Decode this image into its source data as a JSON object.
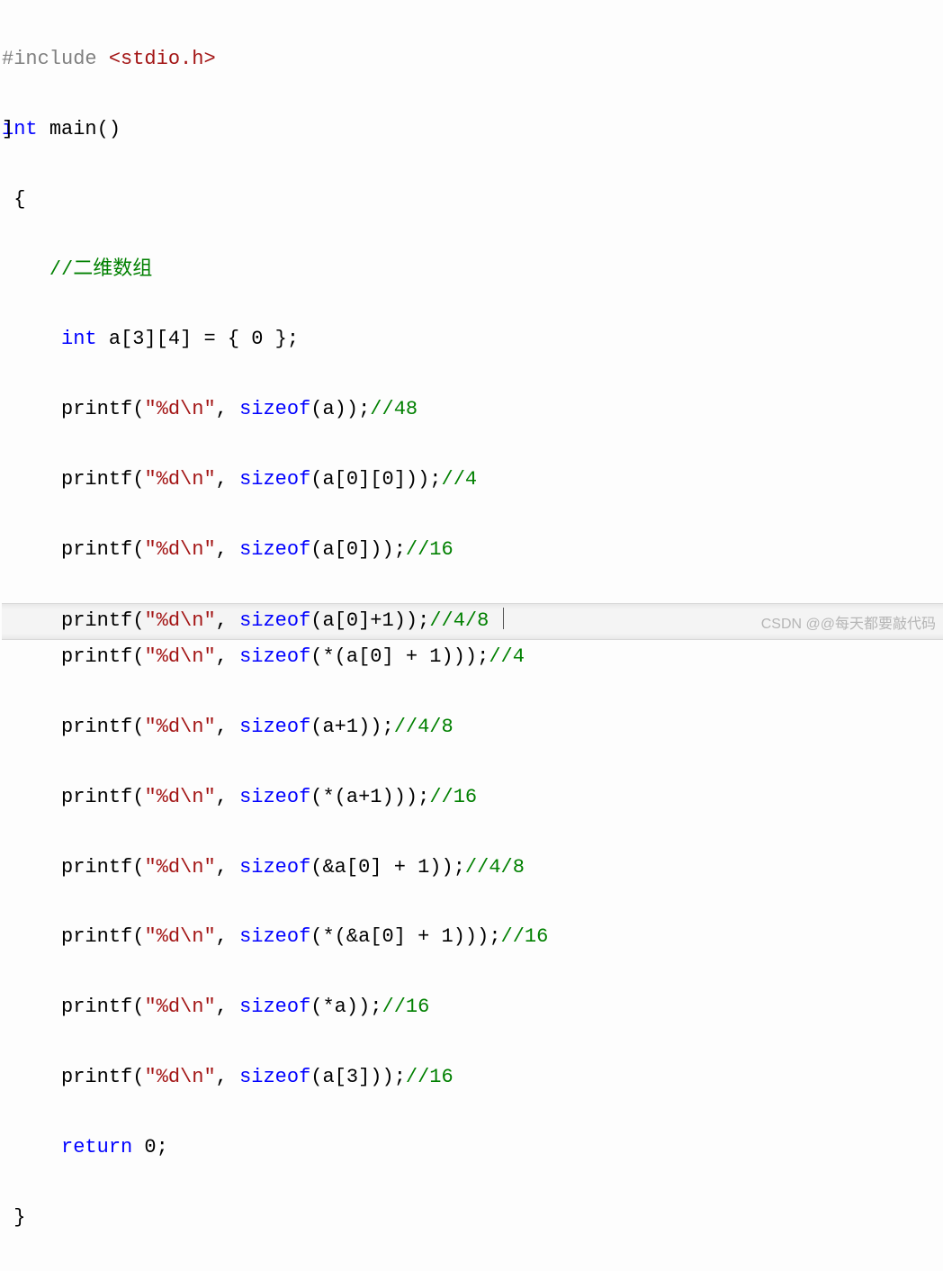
{
  "line1": {
    "preproc": "#include ",
    "path": "<stdio.h>"
  },
  "line2": {
    "kw_int": "int",
    "sp1": " ",
    "main": "main",
    "paren": "()"
  },
  "line3": {
    "brace": "{"
  },
  "line4": {
    "indent": "    ",
    "comment": "//二维数组"
  },
  "line5": {
    "indent": "     ",
    "kw_int": "int",
    "rest": " a[3][4] = { 0 };"
  },
  "line6": {
    "indent": "     ",
    "printf": "printf",
    "p1": "(",
    "str": "\"%d\\n\"",
    "comma": ", ",
    "kw_sizeof": "sizeof",
    "arg": "(a));",
    "comment": "//48"
  },
  "line7": {
    "indent": "     ",
    "printf": "printf",
    "p1": "(",
    "str": "\"%d\\n\"",
    "comma": ", ",
    "kw_sizeof": "sizeof",
    "arg": "(a[0][0]));",
    "comment": "//4"
  },
  "line8": {
    "indent": "     ",
    "printf": "printf",
    "p1": "(",
    "str": "\"%d\\n\"",
    "comma": ", ",
    "kw_sizeof": "sizeof",
    "arg": "(a[0]));",
    "comment": "//16"
  },
  "line9": {
    "indent": "     ",
    "printf": "printf",
    "p1": "(",
    "str": "\"%d\\n\"",
    "comma": ", ",
    "kw_sizeof": "sizeof",
    "arg": "(a[0]+1));",
    "comment": "//4/8 "
  },
  "line10": {
    "indent": "     ",
    "printf": "printf",
    "p1": "(",
    "str": "\"%d\\n\"",
    "comma": ", ",
    "kw_sizeof": "sizeof",
    "arg": "(*(a[0] + 1)));",
    "comment": "//4"
  },
  "line11": {
    "indent": "     ",
    "printf": "printf",
    "p1": "(",
    "str": "\"%d\\n\"",
    "comma": ", ",
    "kw_sizeof": "sizeof",
    "arg": "(a+1));",
    "comment": "//4/8"
  },
  "line12": {
    "indent": "     ",
    "printf": "printf",
    "p1": "(",
    "str": "\"%d\\n\"",
    "comma": ", ",
    "kw_sizeof": "sizeof",
    "arg": "(*(a+1)));",
    "comment": "//16"
  },
  "line13": {
    "indent": "     ",
    "printf": "printf",
    "p1": "(",
    "str": "\"%d\\n\"",
    "comma": ", ",
    "kw_sizeof": "sizeof",
    "arg": "(&a[0] + 1));",
    "comment": "//4/8"
  },
  "line14": {
    "indent": "     ",
    "printf": "printf",
    "p1": "(",
    "str": "\"%d\\n\"",
    "comma": ", ",
    "kw_sizeof": "sizeof",
    "arg": "(*(&a[0] + 1)));",
    "comment": "//16"
  },
  "line15": {
    "indent": "     ",
    "printf": "printf",
    "p1": "(",
    "str": "\"%d\\n\"",
    "comma": ", ",
    "kw_sizeof": "sizeof",
    "arg": "(*a));",
    "comment": "//16"
  },
  "line16": {
    "indent": "     ",
    "printf": "printf",
    "p1": "(",
    "str": "\"%d\\n\"",
    "comma": ", ",
    "kw_sizeof": "sizeof",
    "arg": "(a[3]));",
    "comment": "//16"
  },
  "line17": {
    "indent": "     ",
    "kw_return": "return",
    "rest": " 0;"
  },
  "line18": {
    "brace": "}"
  },
  "watermark": "CSDN @@每天都要敲代码"
}
